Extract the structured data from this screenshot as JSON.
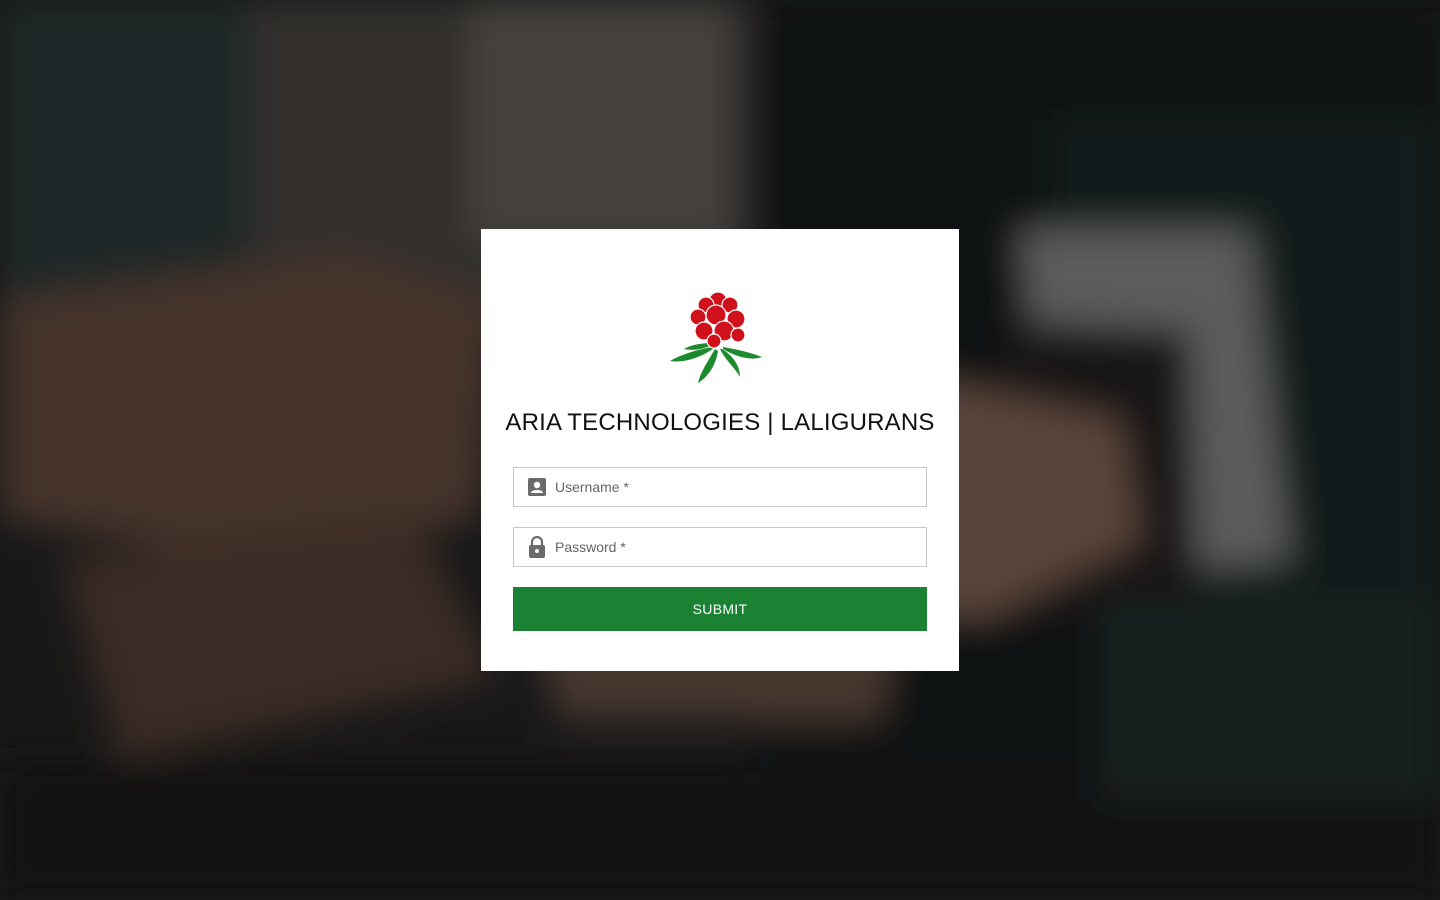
{
  "brand": {
    "title": "ARIA TECHNOLOGIES | LALIGURANS"
  },
  "form": {
    "username": {
      "placeholder": "Username *",
      "value": "",
      "icon": "account-box-icon"
    },
    "password": {
      "placeholder": "Password *",
      "value": "",
      "icon": "lock-icon"
    },
    "submit_label": "SUBMIT"
  },
  "colors": {
    "submit": "#1b8234",
    "logo_petal": "#d0101b",
    "logo_leaf": "#1e8a2e",
    "overlay": "#000000"
  }
}
